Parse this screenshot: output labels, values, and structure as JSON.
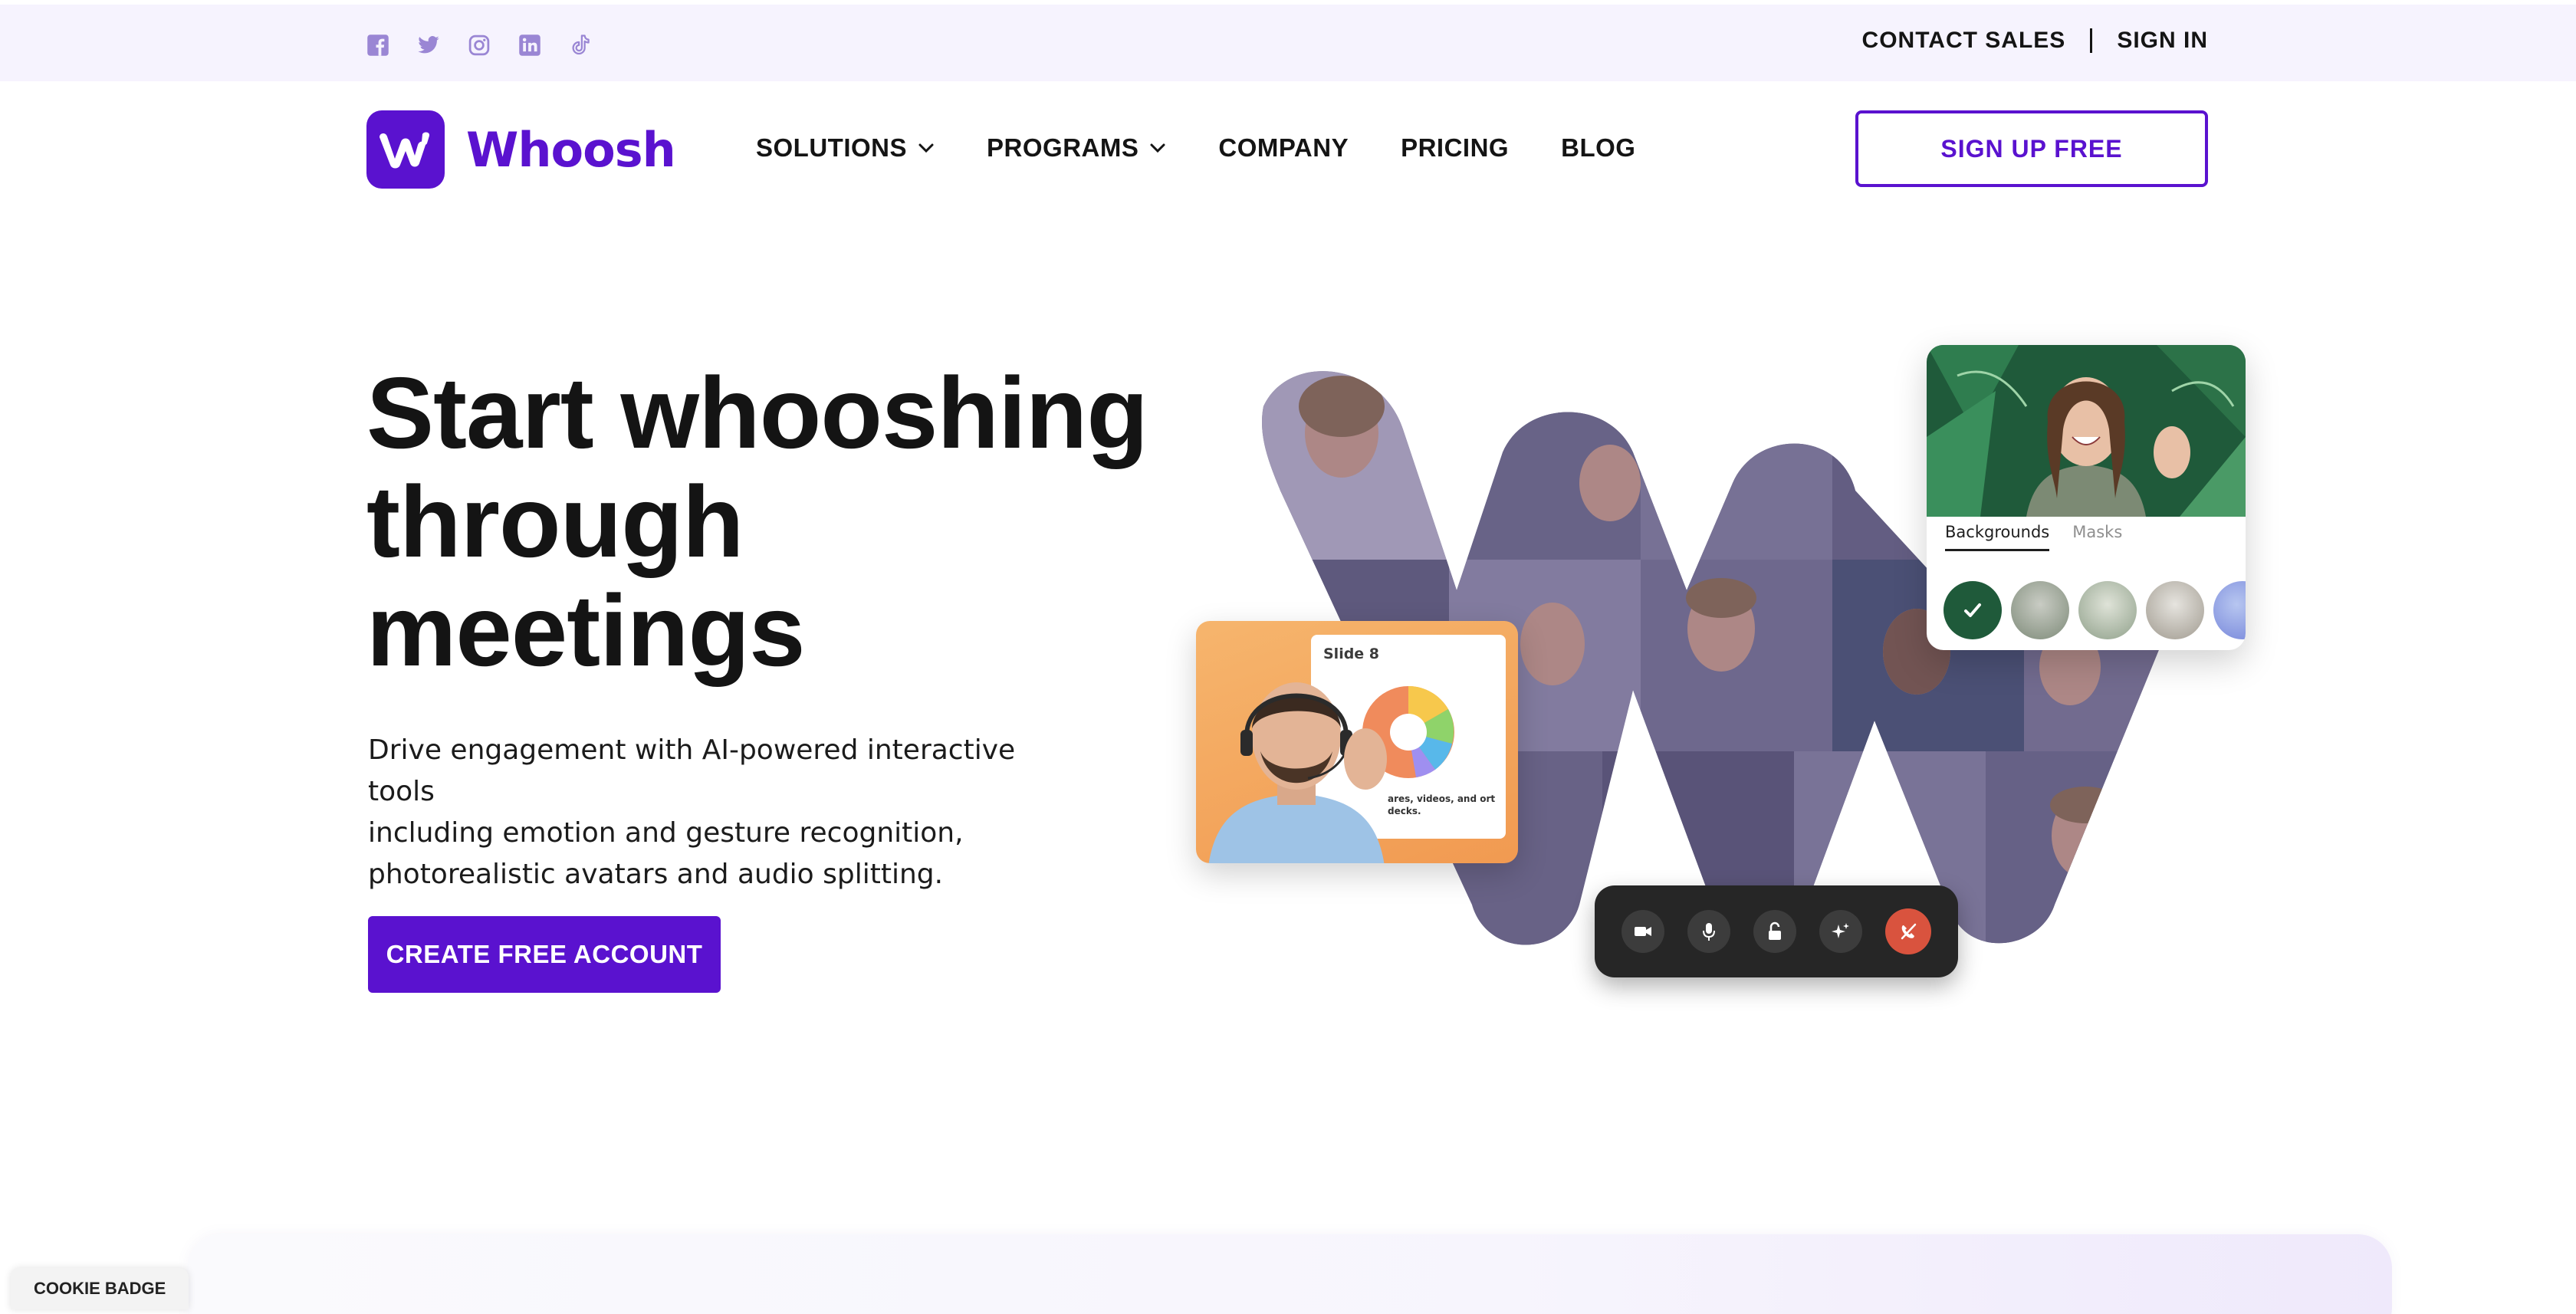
{
  "colors": {
    "brand": "#5a12cf",
    "topbar_bg": "#f6f3fe",
    "social_icon": "#9a86d4",
    "text": "#141414",
    "end_call": "#d9533e",
    "callbar": "#262626"
  },
  "topbar": {
    "social_icons": [
      "facebook-icon",
      "twitter-icon",
      "instagram-icon",
      "linkedin-icon",
      "tiktok-icon"
    ],
    "contact_sales": "CONTACT SALES",
    "sign_in": "SIGN IN"
  },
  "nav": {
    "logo_text": "Whoosh",
    "logo_icon": "whoosh-w-icon",
    "items": [
      {
        "label": "SOLUTIONS",
        "has_dropdown": true
      },
      {
        "label": "PROGRAMS",
        "has_dropdown": true
      },
      {
        "label": "COMPANY",
        "has_dropdown": false
      },
      {
        "label": "PRICING",
        "has_dropdown": false
      },
      {
        "label": "BLOG",
        "has_dropdown": false
      }
    ],
    "signup": "SIGN UP FREE"
  },
  "hero": {
    "title_lines": [
      "Start whooshing",
      "through",
      "meetings"
    ],
    "subtitle_lines": [
      "Drive engagement with AI-powered interactive tools",
      "including emotion and gesture recognition,",
      "photorealistic avatars and audio splitting."
    ],
    "cta": "CREATE FREE ACCOUNT"
  },
  "visual": {
    "slide_label": "Slide 8",
    "slide_caption": "ares, videos, and ort decks.",
    "background_tabs": [
      "Backgrounds",
      "Masks"
    ],
    "active_tab": "Backgrounds",
    "call_controls": [
      "video-camera-icon",
      "microphone-icon",
      "lock-icon",
      "sparkle-effects-icon",
      "end-call-icon"
    ]
  },
  "cookie_badge": "COOKIE BADGE"
}
